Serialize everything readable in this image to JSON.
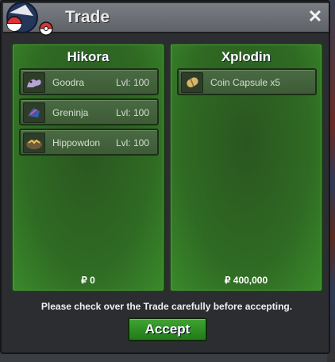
{
  "window": {
    "title": "Trade",
    "close_label": "✕"
  },
  "left": {
    "name": "Hikora",
    "money": "₽ 0",
    "items": [
      {
        "name": "Goodra",
        "level": "Lvl: 100",
        "icon": "goodra-icon"
      },
      {
        "name": "Greninja",
        "level": "Lvl: 100",
        "icon": "greninja-icon"
      },
      {
        "name": "Hippowdon",
        "level": "Lvl: 100",
        "icon": "hippowdon-icon"
      }
    ]
  },
  "right": {
    "name": "Xplodin",
    "money": "₽ 400,000",
    "items": [
      {
        "name": "Coin Capsule x5",
        "icon": "coin-capsule-icon"
      }
    ]
  },
  "notice": "Please check over the Trade carefully before accepting.",
  "accept_label": "Accept",
  "colors": {
    "panel_green": "#2f6a23",
    "button_green": "#2f8f24",
    "titlebar": "#6b6e73"
  }
}
